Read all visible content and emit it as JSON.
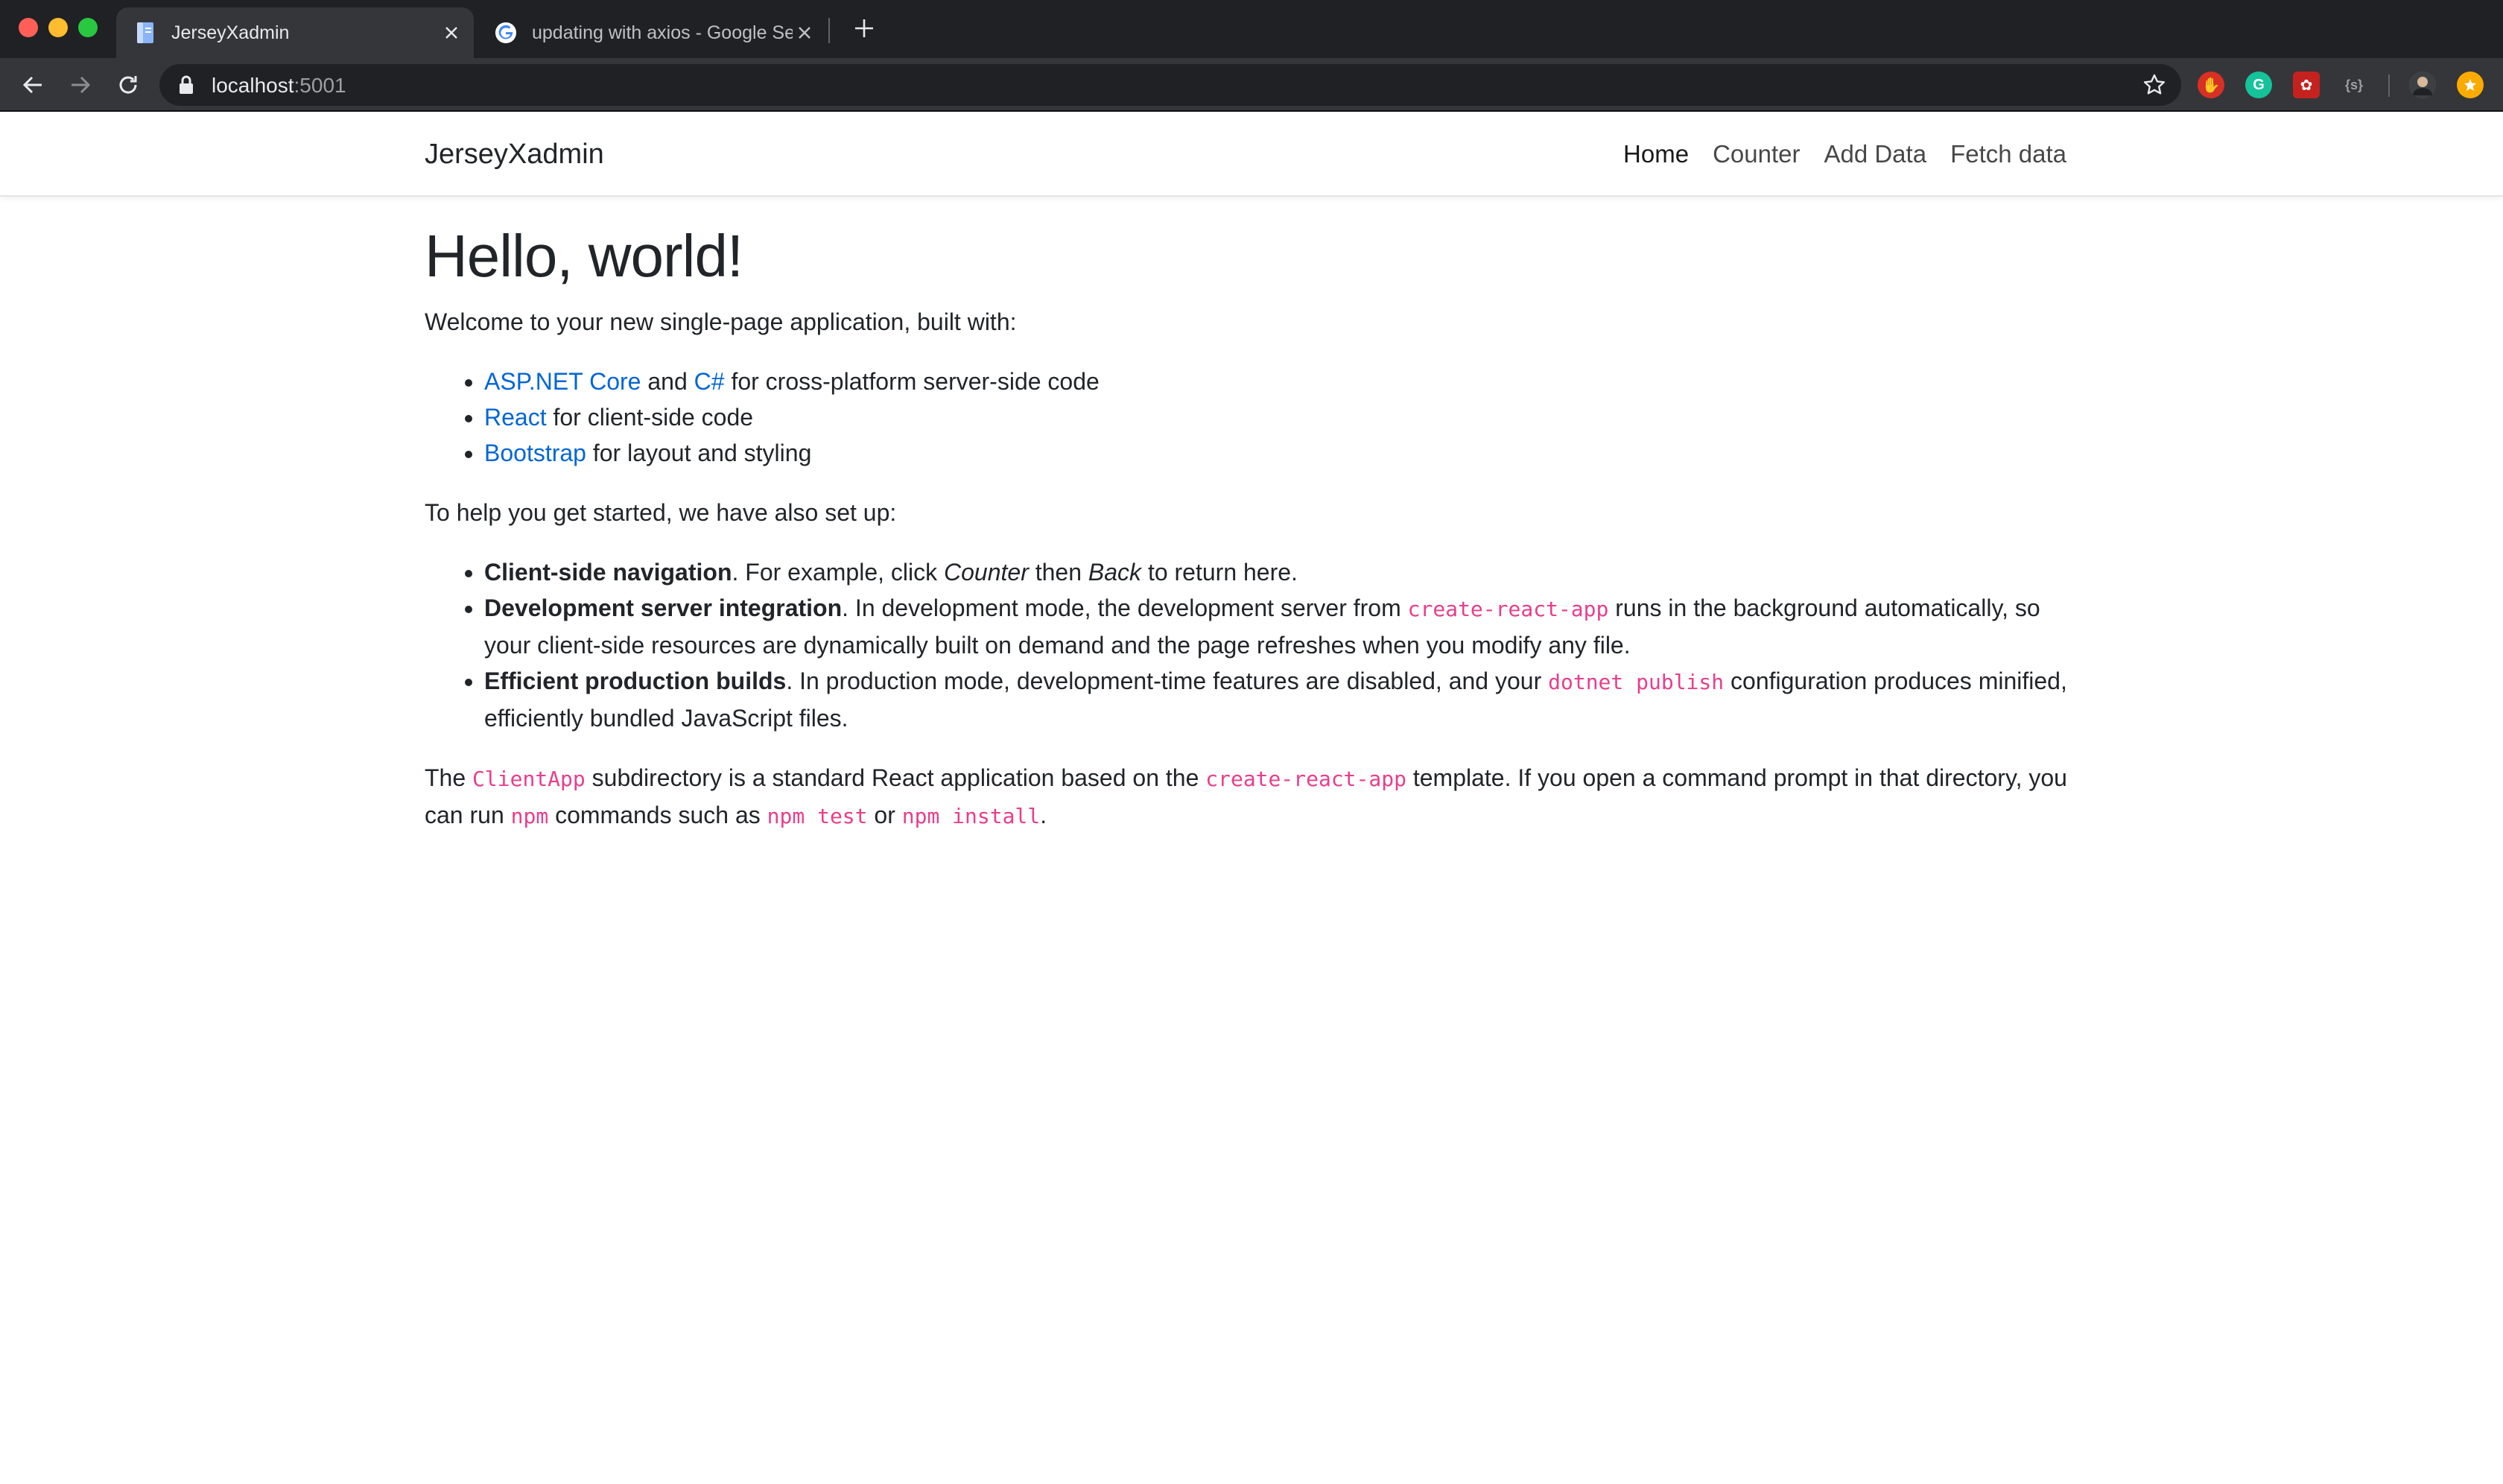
{
  "browser": {
    "tabs": [
      {
        "title": "JerseyXadmin",
        "active": true
      },
      {
        "title": "updating with axios - Google Search",
        "active": false
      }
    ],
    "url": {
      "host": "localhost",
      "port": ":5001"
    }
  },
  "navbar": {
    "brand": "JerseyXadmin",
    "links": [
      "Home",
      "Counter",
      "Add Data",
      "Fetch data"
    ]
  },
  "main": {
    "heading": "Hello, world!",
    "intro": "Welcome to your new single-page application, built with:",
    "built_with": [
      {
        "link1": "ASP.NET Core",
        "mid": " and ",
        "link2": "C#",
        "rest": " for cross-platform server-side code"
      },
      {
        "link1": "React",
        "rest": " for client-side code"
      },
      {
        "link1": "Bootstrap",
        "rest": " for layout and styling"
      }
    ],
    "setup_intro": "To help you get started, we have also set up:",
    "features": [
      {
        "title": "Client-side navigation",
        "t1": ". For example, click ",
        "em1": "Counter",
        "t2": " then ",
        "em2": "Back",
        "t3": " to return here."
      },
      {
        "title": "Development server integration",
        "t1": ". In development mode, the development server from ",
        "code": "create-react-app",
        "t2": " runs in the background automatically, so your client-side resources are dynamically built on demand and the page refreshes when you modify any file."
      },
      {
        "title": "Efficient production builds",
        "t1": ". In production mode, development-time features are disabled, and your ",
        "code": "dotnet publish",
        "t2": " configuration produces minified, efficiently bundled JavaScript files."
      }
    ],
    "closing": {
      "t1": "The ",
      "code1": "ClientApp",
      "t2": " subdirectory is a standard React application based on the ",
      "code2": "create-react-app",
      "t3": " template. If you open a command prompt in that directory, you can run ",
      "code3": "npm",
      "t4": " commands such as ",
      "code4": "npm test",
      "t5": " or ",
      "code5": "npm install",
      "t6": "."
    }
  },
  "colors": {
    "link": "#0366d6",
    "code": "#e83e8c",
    "chrome_dark": "#202124",
    "chrome_toolbar": "#35363a"
  },
  "icons": [
    "back-arrow-icon",
    "forward-arrow-icon",
    "reload-icon",
    "lock-icon",
    "star-icon",
    "page-favicon-icon",
    "google-favicon-icon",
    "close-icon",
    "plus-icon",
    "extension-icon",
    "profile-avatar-icon"
  ]
}
